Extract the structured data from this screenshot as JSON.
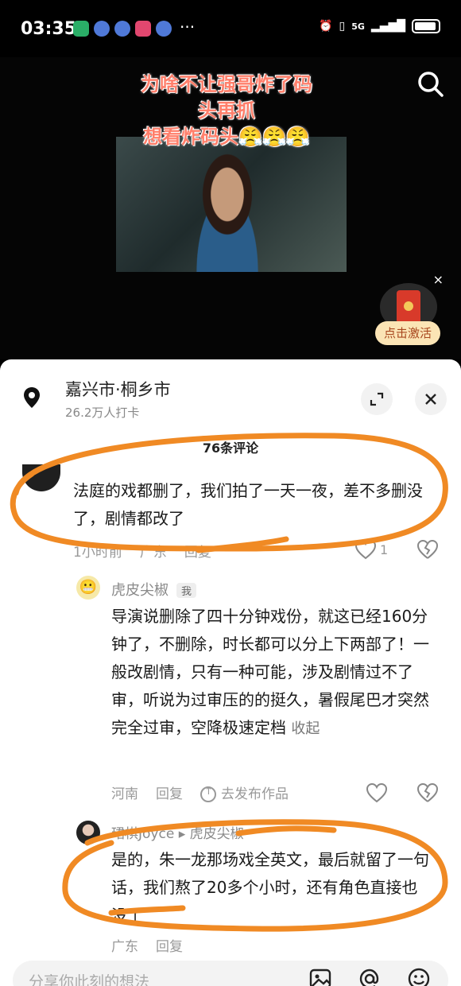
{
  "status_bar": {
    "time": "03:35",
    "network": "5G"
  },
  "video": {
    "overlay_lines": [
      "为啥不让强哥炸了码",
      "头再抓",
      "想看炸码头😤😤😤"
    ],
    "close_label": "×",
    "activate_label": "点击激活"
  },
  "location": {
    "city": "嘉兴市·桐乡市",
    "checkins": "26.2万人打卡"
  },
  "comments_count": "76条评论",
  "comments": [
    {
      "text": "法庭的戏都删了，我们拍了一天一夜，差不多删没了，剧情都改了",
      "time": "1小时前",
      "location": "广东",
      "reply": "回复",
      "likes": "1"
    },
    {
      "user": "虎皮尖椒",
      "me_tag": "我",
      "text": "导演说删除了四十分钟戏份，就这已经160分钟了，不删除，时长都可以分上下两部了！一般改剧情，只有一种可能，涉及剧情过不了审，听说为过审压的的挺久，暑假尾巴才突然完全过审，空降极速定档",
      "collapse": "收起",
      "location": "河南",
      "reply": "回复",
      "post_work": "去发布作品"
    },
    {
      "user": "珺棋Joyce",
      "reply_to": "虎皮尖椒",
      "text": "是的，朱一龙那场戏全英文，最后就留了一句话，我们熬了20多个小时，还有角色直接也没了",
      "location": "广东",
      "reply": "回复"
    }
  ],
  "input": {
    "placeholder": "分享你此刻的想法"
  },
  "colors": {
    "annotation": "#f08a24",
    "overlay_text": "#ff7f6b",
    "activate_bg": "#fbe4b5"
  }
}
